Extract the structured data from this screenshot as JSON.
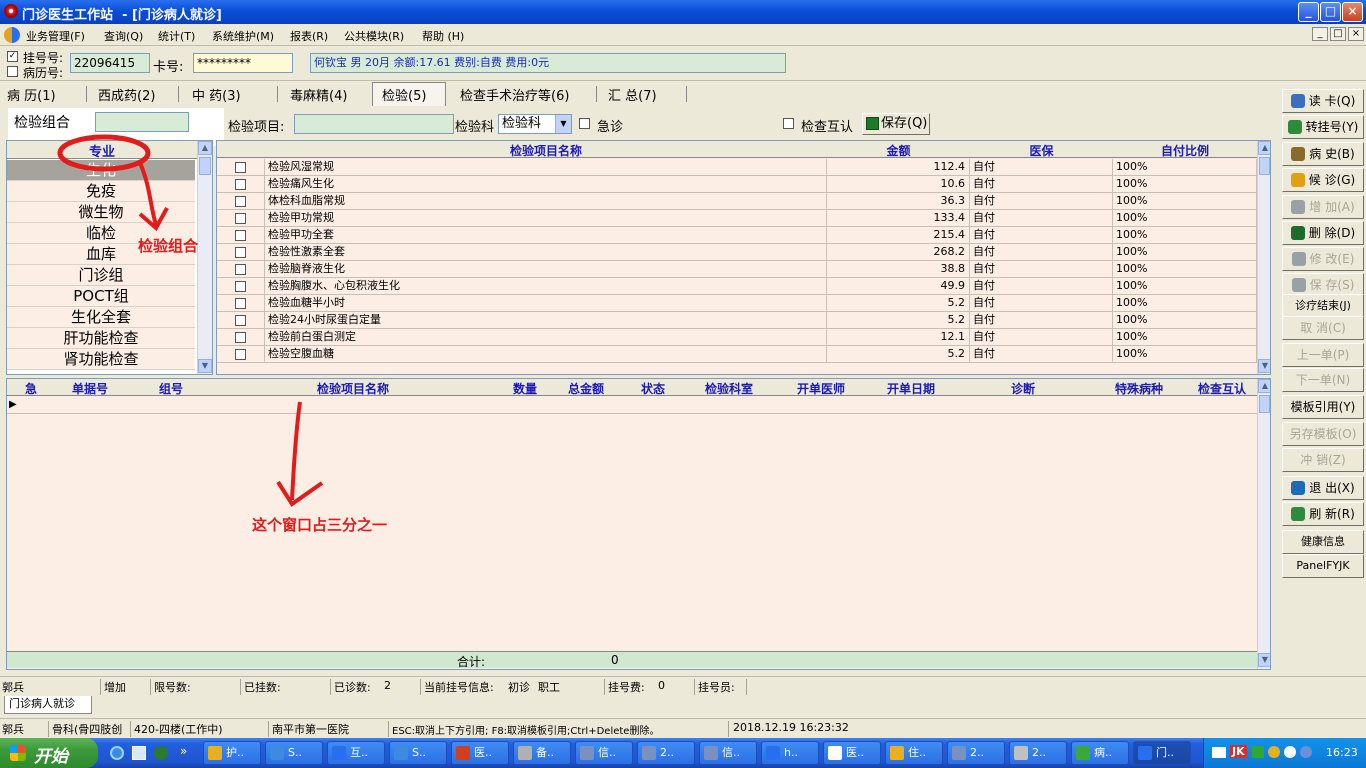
{
  "window": {
    "title": "门诊医生工作站  - [门诊病人就诊]",
    "buttons": [
      "_",
      "□",
      "×"
    ]
  },
  "menu": {
    "items": [
      "业务管理(F)",
      "查询(Q)",
      "统计(T)",
      "系统维护(M)",
      "报表(R)",
      "公共模块(R)",
      "帮助 (H)"
    ],
    "mdi_buttons": [
      "_",
      "□",
      "×"
    ]
  },
  "patient": {
    "reg_label": "挂号号:",
    "record_label": "病历号:",
    "reg_no": "22096415",
    "card_label": "卡号:",
    "card_no": "*********",
    "info": "何钦宝 男 20月 余额:17.61 费别:自费 费用:0元"
  },
  "tabs": [
    "病  历(1)",
    "西成药(2)",
    "中  药(3)",
    "毒麻精(4)",
    "检验(5)",
    "检查手术治疗等(6)",
    "汇  总(7)"
  ],
  "toolbar": {
    "group_label": "检验组合",
    "group_value": "",
    "item_label": "检验项目:",
    "item_value": "",
    "dept_label": "检验科",
    "dept_value": "检验科",
    "urgent_label": "急诊",
    "mutual_label": "检查互认",
    "save_label": "保存(Q)"
  },
  "categories": {
    "header": "专业",
    "items": [
      "生化",
      "免疫",
      "微生物",
      "临检",
      "血库",
      "门诊组",
      "POCT组",
      "生化全套",
      "肝功能检查",
      "肾功能检查"
    ],
    "selected": 0
  },
  "item_grid": {
    "headers": [
      "",
      "检验项目名称",
      "金额",
      "医保",
      "自付比例"
    ],
    "rows": [
      {
        "name": "检验风湿常规",
        "amount": "112.4",
        "insurance": "自付",
        "ratio": "100%"
      },
      {
        "name": "检验痛风生化",
        "amount": "10.6",
        "insurance": "自付",
        "ratio": "100%"
      },
      {
        "name": "体检科血脂常规",
        "amount": "36.3",
        "insurance": "自付",
        "ratio": "100%"
      },
      {
        "name": "检验甲功常规",
        "amount": "133.4",
        "insurance": "自付",
        "ratio": "100%"
      },
      {
        "name": "检验甲功全套",
        "amount": "215.4",
        "insurance": "自付",
        "ratio": "100%"
      },
      {
        "name": "检验性激素全套",
        "amount": "268.2",
        "insurance": "自付",
        "ratio": "100%"
      },
      {
        "name": "检验脑脊液生化",
        "amount": "38.8",
        "insurance": "自付",
        "ratio": "100%"
      },
      {
        "name": "检验胸腹水、心包积液生化",
        "amount": "49.9",
        "insurance": "自付",
        "ratio": "100%"
      },
      {
        "name": "检验血糖半小时",
        "amount": "5.2",
        "insurance": "自付",
        "ratio": "100%"
      },
      {
        "name": "检验24小时尿蛋白定量",
        "amount": "5.2",
        "insurance": "自付",
        "ratio": "100%"
      },
      {
        "name": "检验前白蛋白测定",
        "amount": "12.1",
        "insurance": "自付",
        "ratio": "100%"
      },
      {
        "name": "检验空腹血糖",
        "amount": "5.2",
        "insurance": "自付",
        "ratio": "100%"
      }
    ]
  },
  "order_grid": {
    "headers": [
      "急",
      "单据号",
      "组号",
      "检验项目名称",
      "数量",
      "总金额",
      "状态",
      "检验科室",
      "开单医师",
      "开单日期",
      "诊断",
      "特殊病种",
      "检查互认"
    ],
    "total_label": "合计:",
    "total_value": "0"
  },
  "side_buttons": [
    "读 卡(Q)",
    "转挂号(Y)",
    "病  史(B)",
    "候  诊(G)",
    "增  加(A)",
    "删  除(D)",
    "修  改(E)",
    "保  存(S)",
    "诊疗结束(J)",
    "取  消(C)",
    "上一单(P)",
    "下一单(N)",
    "模板引用(Y)",
    "另存模板(O)",
    "冲  销(Z)",
    "退  出(X)",
    "刷  新(R)",
    "健康信息",
    "PanelFYJK"
  ],
  "side_disabled": [
    4,
    6,
    7,
    9,
    10,
    11,
    13,
    14
  ],
  "annotations": {
    "circle_label": "检验组合",
    "window_note": "这个窗口占三分之一"
  },
  "status": {
    "user": "郭兵",
    "mode": "增加",
    "limit_label": "限号数:",
    "registered_label": "已挂数:",
    "seen_label": "已诊数:",
    "seen_value": "2",
    "current_label": "当前挂号信息:",
    "visit_type": "初诊",
    "category": "职工",
    "fee_label": "挂号费:",
    "fee_value": "0",
    "clerk_label": "挂号员:",
    "tab_label": "门诊病人就诊",
    "user2": "郭兵",
    "department": "骨科(骨四肢创",
    "room": "420-四楼(工作中)",
    "hospital": "南平市第一医院",
    "hint": "ESC:取消上下方引用; F8:取消模板引用;Ctrl+Delete删除。",
    "datetime": "2018.12.19 16:23:32"
  },
  "taskbar": {
    "start": "开始",
    "tasks": [
      "护..",
      "S..",
      "互..",
      "S..",
      "医..",
      "备..",
      "信..",
      "2..",
      "信..",
      "h..",
      "医..",
      "住..",
      "2..",
      "2..",
      "病..",
      "门.."
    ],
    "clock": "16:23"
  }
}
